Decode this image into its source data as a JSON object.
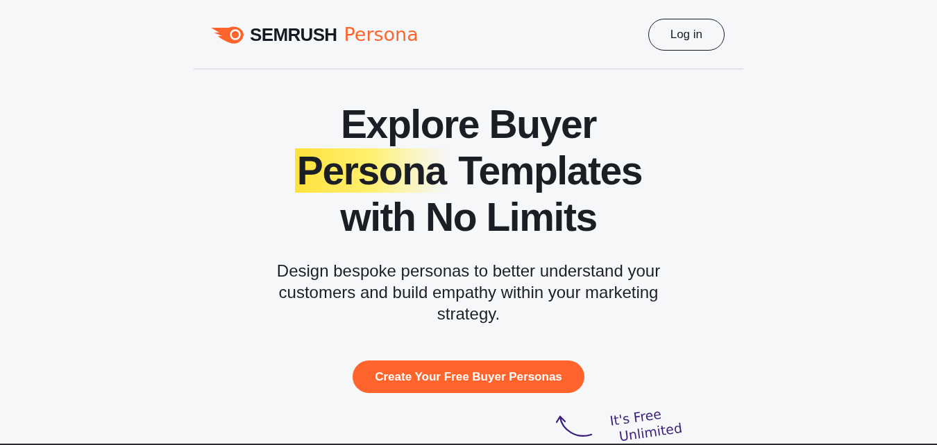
{
  "header": {
    "logo": {
      "brand": "SEMRUSH",
      "product": "Persona"
    },
    "login_button": "Log in"
  },
  "hero": {
    "heading": [
      {
        "text": "Explore Buyer",
        "highlighted": false,
        "break_after": true
      },
      {
        "text": "Persona",
        "highlighted": true,
        "break_after": false
      },
      {
        "text": " Templates",
        "highlighted": false,
        "break_after": true
      },
      {
        "text": "with No Limits",
        "highlighted": false,
        "break_after": false
      }
    ],
    "subtitle": "Design bespoke personas to better understand your customers and build empathy within your marketing strategy.",
    "cta_button": "Create Your Free Buyer Personas",
    "note": [
      "It's Free",
      "Unlimited"
    ]
  }
}
